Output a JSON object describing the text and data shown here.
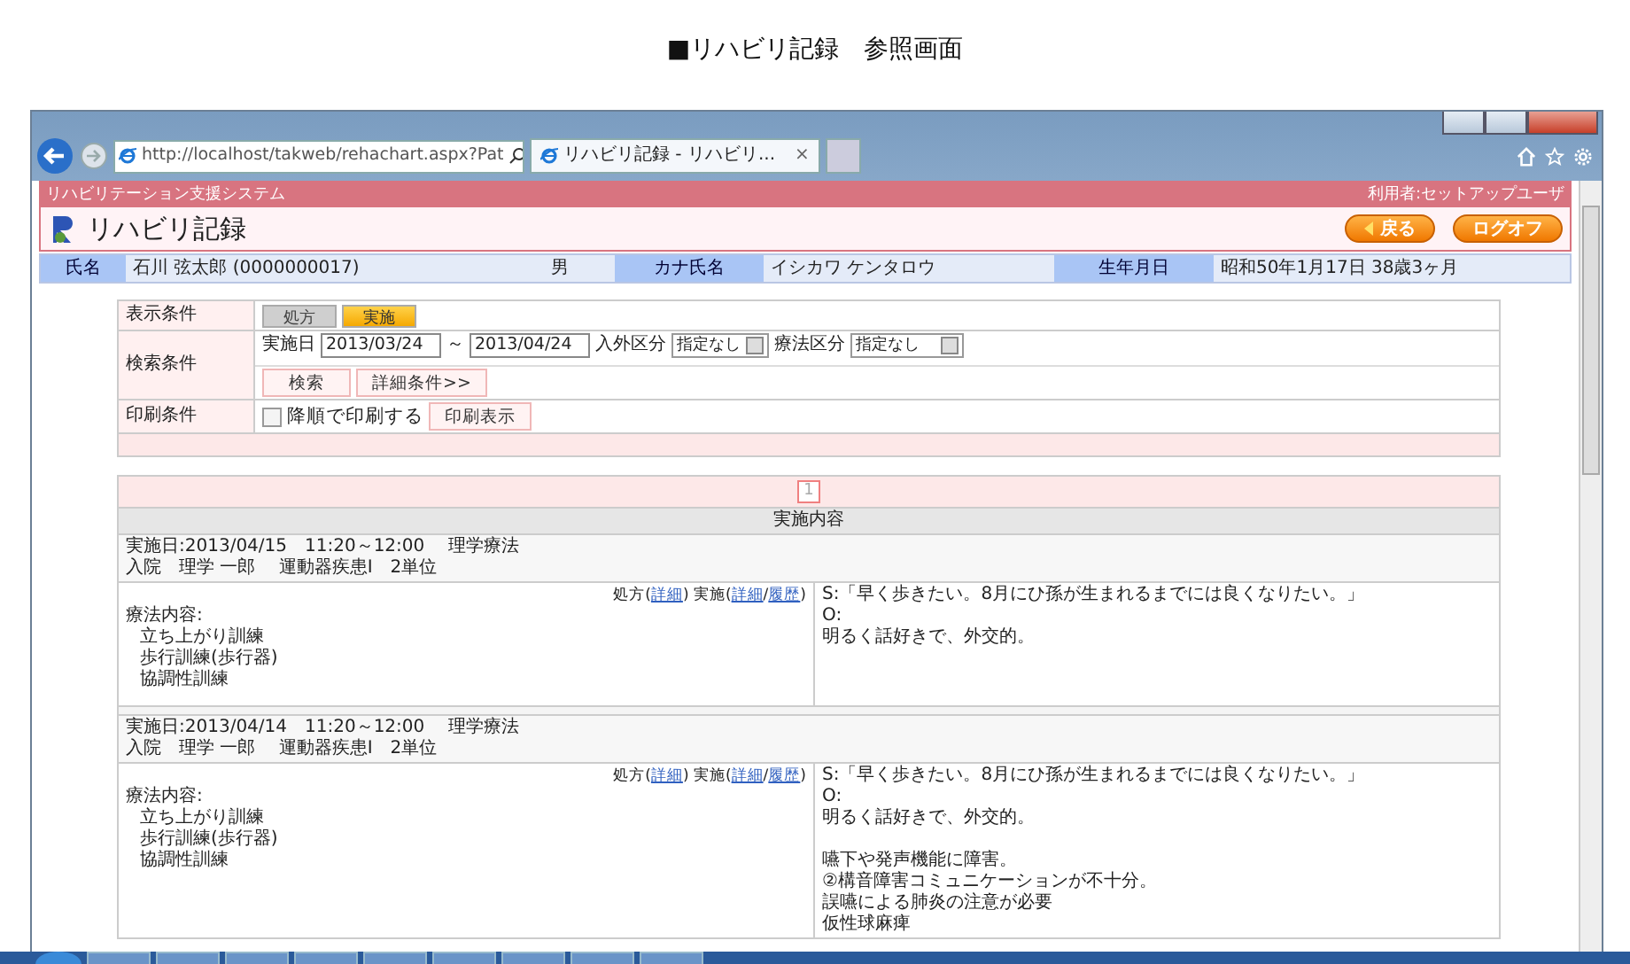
{
  "caption": "■リハビリ記録　参照画面",
  "browser": {
    "address": "http://localhost/takweb/rehachart.aspx?Pat",
    "tab_title": "リハビリ記録 - リハビリ...",
    "tab_close": "×"
  },
  "header": {
    "system_name": "リハビリテーション支援システム",
    "user": "利用者:セットアップユーザ",
    "title": "リハビリ記録",
    "buttons": [
      {
        "label": "戻る",
        "kind": "back"
      },
      {
        "label": "ログオフ",
        "kind": "plain"
      }
    ]
  },
  "patient": [
    {
      "kind": "label",
      "text": "氏名"
    },
    {
      "kind": "value",
      "text": "石川 弦太郎 (0000000017)"
    },
    {
      "kind": "value",
      "text": "男"
    },
    {
      "kind": "label",
      "text": "カナ氏名"
    },
    {
      "kind": "value",
      "text": "イシカワ ケンタロウ"
    },
    {
      "kind": "label",
      "text": "生年月日"
    },
    {
      "kind": "value",
      "text": "昭和50年1月17日 38歳3ヶ月"
    }
  ],
  "conditions": {
    "display": {
      "label": "表示条件",
      "toggles": [
        {
          "label": "処方",
          "selected": false
        },
        {
          "label": "実施",
          "selected": true
        }
      ]
    },
    "search": {
      "label": "検索条件",
      "date_label": "実施日",
      "date_from": "2013/03/24",
      "tilde": "～",
      "date_to": "2013/04/24",
      "inout_label": "入外区分",
      "inout_value": "指定なし",
      "therapy_label": "療法区分",
      "therapy_value": "指定なし",
      "buttons": [
        "検索",
        "詳細条件>>"
      ]
    },
    "print": {
      "label": "印刷条件",
      "checkbox": {
        "label": "降順で印刷する",
        "checked": false
      },
      "button": "印刷表示"
    }
  },
  "results": {
    "pages": [
      {
        "label": "1",
        "selected": true
      }
    ],
    "column": "実施内容",
    "records": [
      {
        "date_line": "実施日:2013/04/15　11:20～12:00　 理学療法",
        "info_line": "入院　理学 一郎　 運動器疾患Ⅰ　2単位",
        "content_label": "療法内容:",
        "items": [
          "立ち上がり訓練",
          "歩行訓練(歩行器)",
          "協調性訓練"
        ],
        "links": [
          {
            "kind": "text",
            "text": "処方("
          },
          {
            "kind": "link",
            "text": "詳細"
          },
          {
            "kind": "text",
            "text": ") 実施("
          },
          {
            "kind": "link",
            "text": "詳細"
          },
          {
            "kind": "text",
            "text": "/"
          },
          {
            "kind": "link",
            "text": "履歴"
          },
          {
            "kind": "text",
            "text": ")"
          }
        ],
        "note_groups": [
          [
            "S:「早く歩きたい。8月にひ孫が生まれるまでには良くなりたい。」",
            "O:",
            "明るく話好きで、外交的。"
          ]
        ]
      },
      {
        "date_line": "実施日:2013/04/14　11:20～12:00　 理学療法",
        "info_line": "入院　理学 一郎　 運動器疾患Ⅰ　2単位",
        "content_label": "療法内容:",
        "items": [
          "立ち上がり訓練",
          "歩行訓練(歩行器)",
          "協調性訓練"
        ],
        "links": [
          {
            "kind": "text",
            "text": "処方("
          },
          {
            "kind": "link",
            "text": "詳細"
          },
          {
            "kind": "text",
            "text": ") 実施("
          },
          {
            "kind": "link",
            "text": "詳細"
          },
          {
            "kind": "text",
            "text": "/"
          },
          {
            "kind": "link",
            "text": "履歴"
          },
          {
            "kind": "text",
            "text": ")"
          }
        ],
        "note_groups": [
          [
            "S:「早く歩きたい。8月にひ孫が生まれるまでには良くなりたい。」",
            "O:",
            "明るく話好きで、外交的。"
          ],
          [
            "嚥下や発声機能に障害。",
            "②構音障害コミュニケーションが不十分。",
            "誤嚥による肺炎の注意が必要",
            "仮性球麻痺"
          ]
        ]
      }
    ]
  }
}
